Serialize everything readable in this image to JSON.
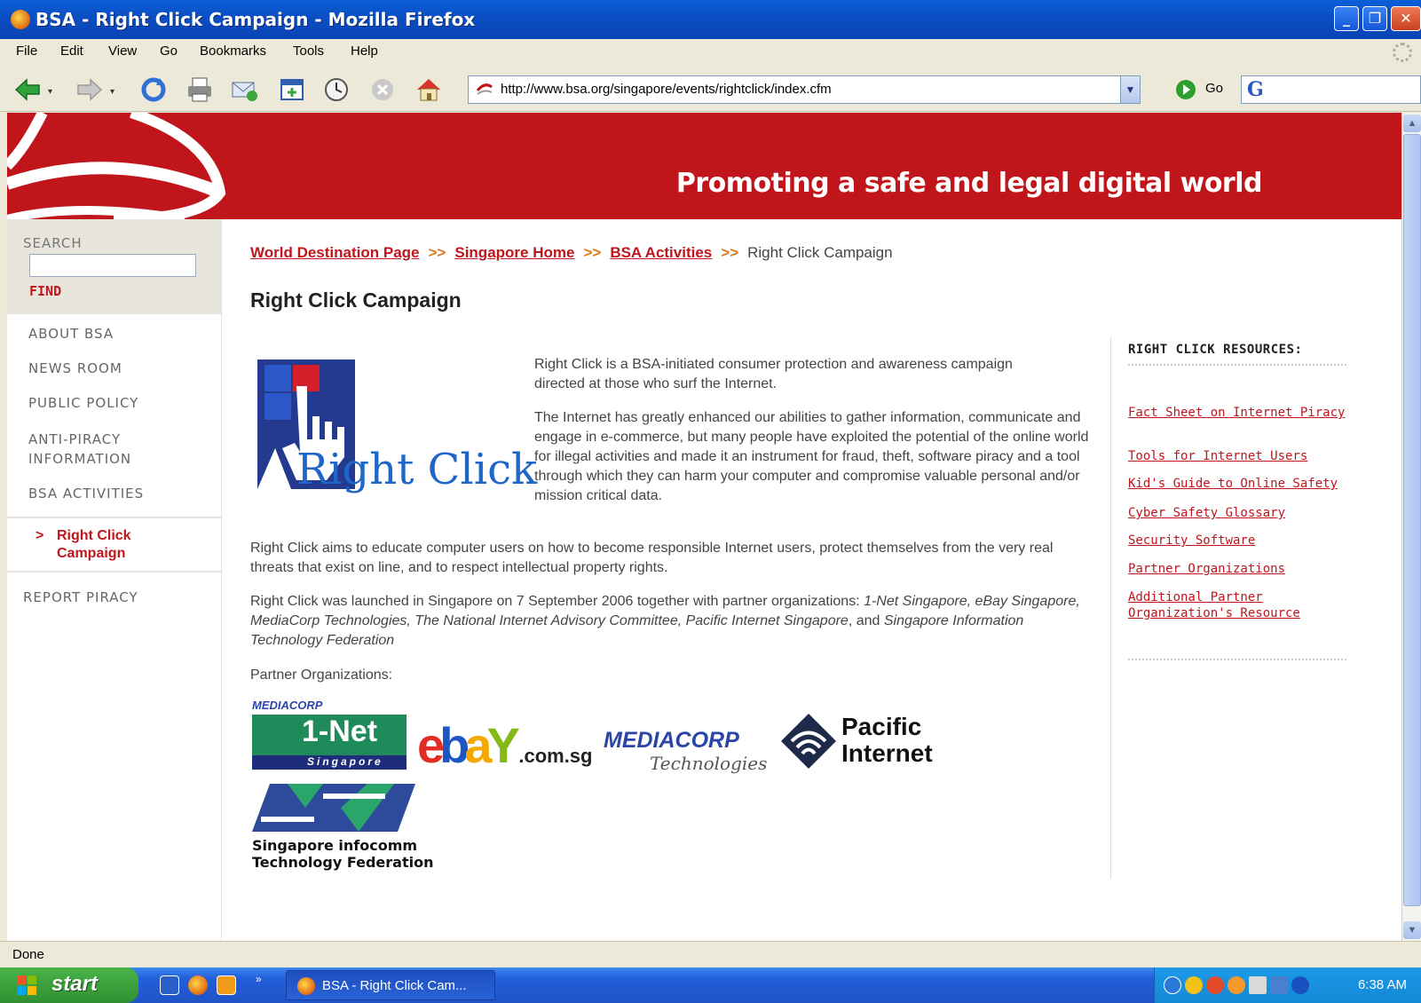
{
  "window": {
    "title": "BSA - Right Click Campaign - Mozilla Firefox"
  },
  "menu": [
    "File",
    "Edit",
    "View",
    "Go",
    "Bookmarks",
    "Tools",
    "Help"
  ],
  "address": {
    "url": "http://www.bsa.org/singapore/events/rightclick/index.cfm"
  },
  "go_label": "Go",
  "search_engine_label": "G",
  "banner": {
    "slogan": "Promoting a safe and legal digital world"
  },
  "sidebar": {
    "search_label": "SEARCH",
    "find_label": "FIND",
    "items": [
      "ABOUT BSA",
      "NEWS ROOM",
      "PUBLIC POLICY",
      "ANTI-PIRACY\nINFORMATION",
      "BSA ACTIVITIES"
    ],
    "sub_marker": ">",
    "sub_item": "Right Click Campaign",
    "report": "REPORT PIRACY"
  },
  "breadcrumb": {
    "links": [
      "World Destination Page",
      "Singapore Home",
      "BSA Activities"
    ],
    "separator": ">>",
    "current": "Right Click Campaign"
  },
  "page": {
    "title": "Right Click Campaign",
    "logo_text": "Right Click",
    "intro1": "Right Click is a BSA-initiated consumer protection and awareness campaign directed at those who surf the Internet.",
    "intro2": "The Internet has greatly enhanced our abilities to gather information, communicate and engage in e-commerce, but many people have exploited the potential of the online world for illegal activities and made it an instrument for fraud, theft, software piracy and a tool through which they can harm your computer and compromise valuable personal and/or mission critical data.",
    "aims": "Right Click aims to educate computer users on how to become responsible Internet users, protect themselves from the very real threats that exist on line, and to respect intellectual property rights.",
    "launched_pre": "Right Click was launched in Singapore on 7 September 2006 together with partner organizations: ",
    "launched_p1": "1-Net Singapore, eBay Singapore, MediaCorp Technologies, The National Internet Advisory Committee, Pacific Internet Singapore",
    "launched_mid": ", and ",
    "launched_p2": "Singapore Information Technology Federation",
    "partners_label": "Partner Organizations:"
  },
  "partners": {
    "onenet_top": "MEDIACORP",
    "onenet_name": "1-Net",
    "onenet_sub": "Singapore",
    "ebay_domain": ".com.sg",
    "mediacorp_name": "MEDIACORP",
    "mediacorp_sub": "Technologies",
    "pacific_line1": "Pacific",
    "pacific_line2": "Internet",
    "sitf_line1": "Singapore infocomm",
    "sitf_line2": "Technology Federation"
  },
  "resources": {
    "heading": "RIGHT CLICK RESOURCES:",
    "links": [
      "Fact Sheet on Internet Piracy",
      "Tools for Internet Users",
      "Kid's Guide to Online Safety",
      "Cyber Safety Glossary",
      "Security Software",
      "Partner Organizations",
      "Additional Partner Organization's Resource"
    ]
  },
  "status": "Done",
  "taskbar": {
    "start": "start",
    "task": "BSA - Right Click Cam...",
    "time": "6:38 AM"
  },
  "colors": {
    "brand_red": "#c0151b",
    "link_orange": "#e07818"
  }
}
